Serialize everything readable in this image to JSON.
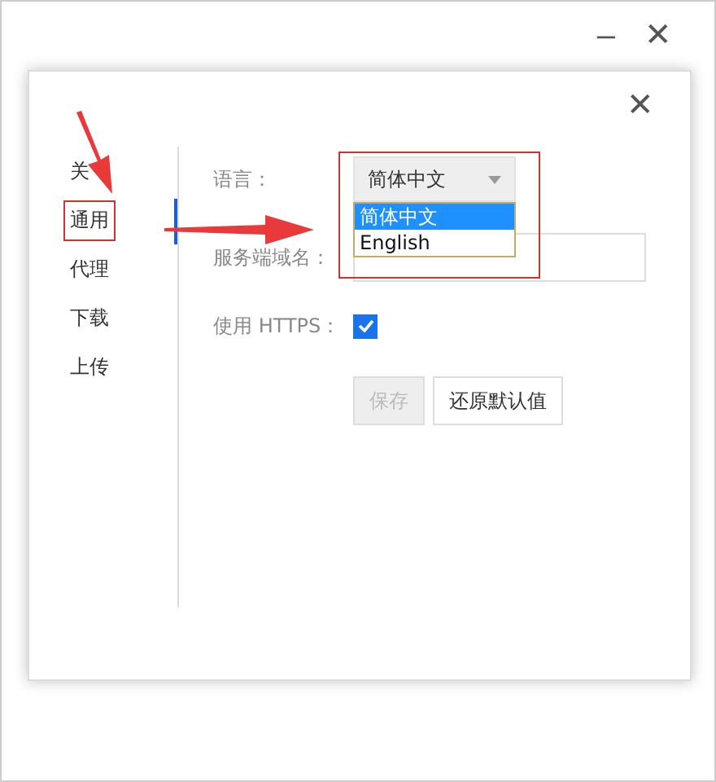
{
  "window": {
    "minimize": "–",
    "close": "✕"
  },
  "dialog": {
    "close": "✕"
  },
  "sidebar": {
    "items": [
      {
        "label": "关",
        "selected": false
      },
      {
        "label": "通用",
        "selected": true
      },
      {
        "label": "代理",
        "selected": false
      },
      {
        "label": "下载",
        "selected": false
      },
      {
        "label": "上传",
        "selected": false
      }
    ]
  },
  "form": {
    "language": {
      "label": "语言：",
      "value": "简体中文",
      "expanded": true,
      "options": [
        {
          "label": "简体中文",
          "selected": true
        },
        {
          "label": "English",
          "selected": false
        }
      ]
    },
    "server": {
      "label": "服务端域名："
    },
    "https": {
      "label": "使用 HTTPS：",
      "checked": true
    },
    "buttons": [
      {
        "label": "保存",
        "disabled": true
      },
      {
        "label": "还原默认值",
        "disabled": false
      }
    ]
  }
}
